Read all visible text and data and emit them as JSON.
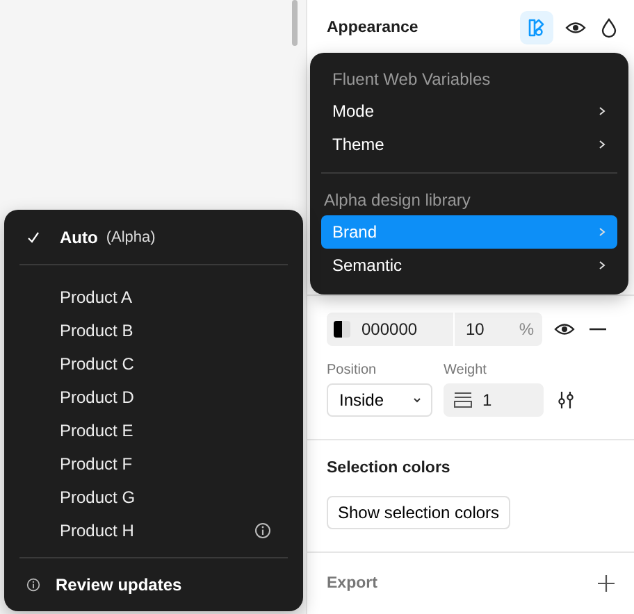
{
  "appearance": {
    "title": "Appearance",
    "variables_active": true
  },
  "stroke": {
    "hex_value": "000000",
    "opacity": "10",
    "unit": "%",
    "position_label": "Position",
    "position": "Inside",
    "weight_label": "Weight",
    "weight": "1"
  },
  "selection_colors": {
    "title": "Selection colors",
    "button": "Show selection colors"
  },
  "export": {
    "title": "Export"
  },
  "variables_menu": {
    "sections": [
      {
        "heading": "Fluent Web Variables",
        "items": [
          {
            "label": "Mode",
            "selected": false
          },
          {
            "label": "Theme",
            "selected": false
          }
        ]
      },
      {
        "heading": "Alpha design library",
        "items": [
          {
            "label": "Brand",
            "selected": true
          },
          {
            "label": "Semantic",
            "selected": false
          }
        ]
      }
    ]
  },
  "mode_menu": {
    "auto": {
      "label": "Auto",
      "note": "(Alpha)",
      "checked": true
    },
    "items": [
      {
        "label": "Product A",
        "checked": false,
        "info": false
      },
      {
        "label": "Product B",
        "checked": false,
        "info": false
      },
      {
        "label": "Product C",
        "checked": false,
        "info": false
      },
      {
        "label": "Product D",
        "checked": false,
        "info": false
      },
      {
        "label": "Product E",
        "checked": false,
        "info": false
      },
      {
        "label": "Product F",
        "checked": false,
        "info": false
      },
      {
        "label": "Product G",
        "checked": false,
        "info": false
      },
      {
        "label": "Product H",
        "checked": false,
        "info": true
      }
    ],
    "footer": "Review updates"
  }
}
